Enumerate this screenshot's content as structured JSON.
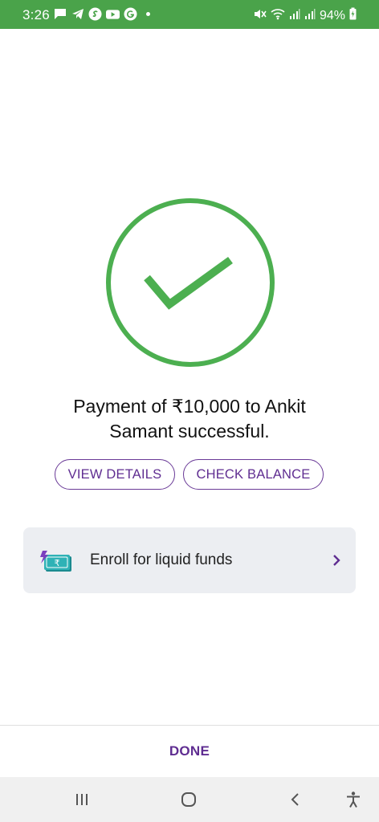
{
  "status_bar": {
    "time": "3:26",
    "battery": "94%",
    "left_icons": [
      "message-icon",
      "telegram-icon",
      "shazam-icon",
      "youtube-icon",
      "google-icon",
      "dot-icon"
    ],
    "right_icons": [
      "mute-icon",
      "wifi-icon",
      "signal-icon",
      "signal-icon",
      "battery-charging-icon"
    ]
  },
  "result": {
    "status_icon": "check-circle-icon",
    "accent_color": "#4caf50",
    "message_line1": "Payment of ₹10,000 to Ankit",
    "message_line2": "Samant successful."
  },
  "actions": {
    "view_details": "VIEW DETAILS",
    "check_balance": "CHECK BALANCE"
  },
  "enroll_card": {
    "icon": "liquid-funds-icon",
    "label": "Enroll for liquid funds",
    "chevron": "chevron-right-icon"
  },
  "footer": {
    "done_label": "DONE",
    "brand_color": "#5f2d91"
  },
  "nav_bar": {
    "buttons": [
      "recents-icon",
      "home-icon",
      "back-icon",
      "accessibility-icon"
    ]
  }
}
